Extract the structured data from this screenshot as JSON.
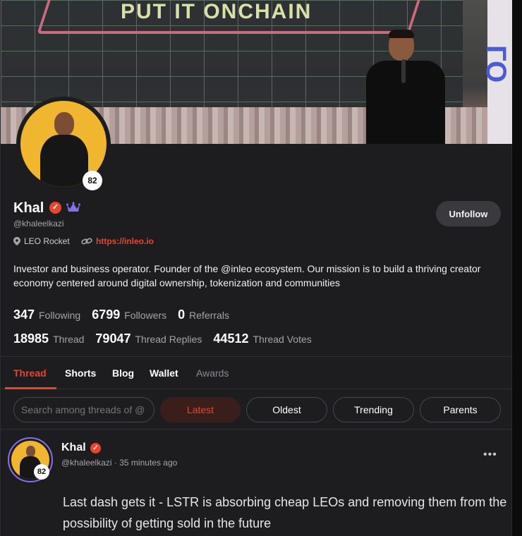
{
  "banner": {
    "text": "PUT IT ONCHAIN",
    "side_text": "ГО"
  },
  "profile": {
    "name": "Khal",
    "handle": "@khaleelkazi",
    "level": "82",
    "location": "LEO Rocket",
    "website": "https://inleo.io",
    "bio": "Investor and business operator. Founder of the @inleo ecosystem. Our mission is to build a thriving creator economy centered around digital ownership, tokenization and communities",
    "unfollow_label": "Unfollow"
  },
  "stats": {
    "row1": [
      {
        "value": "347",
        "label": "Following"
      },
      {
        "value": "6799",
        "label": "Followers"
      },
      {
        "value": "0",
        "label": "Referrals"
      }
    ],
    "row2": [
      {
        "value": "18985",
        "label": "Thread"
      },
      {
        "value": "79047",
        "label": "Thread Replies"
      },
      {
        "value": "44512",
        "label": "Thread Votes"
      }
    ]
  },
  "tabs": [
    {
      "label": "Thread"
    },
    {
      "label": "Shorts"
    },
    {
      "label": "Blog"
    },
    {
      "label": "Wallet"
    },
    {
      "label": "Awards"
    }
  ],
  "filters": {
    "search_placeholder": "Search among threads of @",
    "options": [
      "Latest",
      "Oldest",
      "Trending",
      "Parents"
    ]
  },
  "post": {
    "author": "Khal",
    "handle": "@khaleelkazi",
    "time": "35 minutes ago",
    "level": "82",
    "more_label": "•••",
    "body": "Last dash gets it - LSTR is absorbing cheap LEOs and removing them from the possibility of getting sold in the future"
  },
  "colors": {
    "accent": "#e8452d",
    "background": "#1d1d20",
    "avatar_bg": "#f0b62f",
    "ring": "#8a6cf0"
  },
  "icons": [
    "verified-icon",
    "crown-icon",
    "location-pin-icon",
    "link-icon",
    "more-icon"
  ]
}
